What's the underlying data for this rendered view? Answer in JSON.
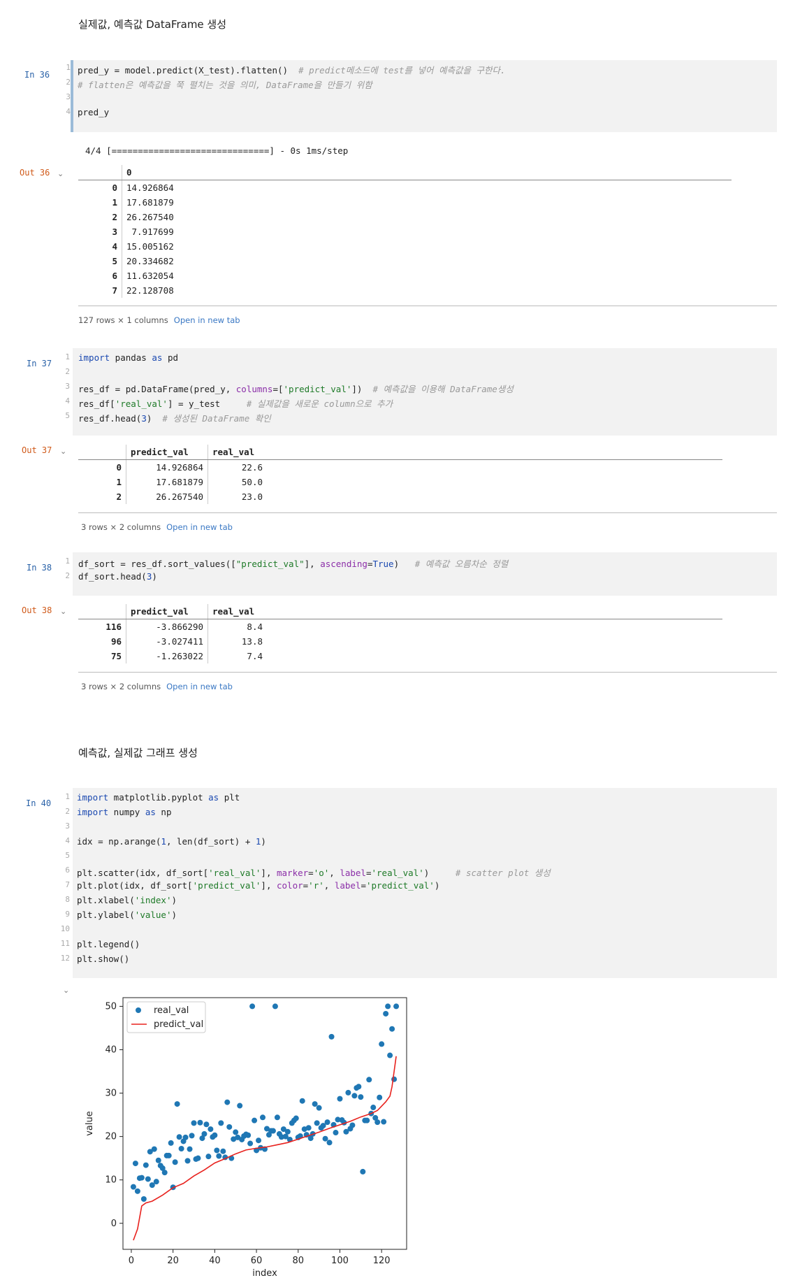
{
  "md1": "실제값, 예측값 DataFrame 생성",
  "md2": "예측값, 실제값 그래프 생성",
  "cells": {
    "in36": "In 36",
    "out36": "Out 36",
    "in37": "In 37",
    "out37": "Out 37",
    "in38": "In 38",
    "out38": "Out 38",
    "in40": "In 40"
  },
  "progress_line": "4/4 [==============================] - 0s 1ms/step",
  "table36": {
    "column": "0",
    "rows": [
      {
        "idx": "0",
        "val": "14.926864"
      },
      {
        "idx": "1",
        "val": "17.681879"
      },
      {
        "idx": "2",
        "val": "26.267540"
      },
      {
        "idx": "3",
        "val": "7.917699"
      },
      {
        "idx": "4",
        "val": "15.005162"
      },
      {
        "idx": "5",
        "val": "20.334682"
      },
      {
        "idx": "6",
        "val": "11.632054"
      },
      {
        "idx": "7",
        "val": "22.128708"
      }
    ],
    "footer": "127 rows × 1 columns",
    "link": "Open in new tab"
  },
  "table37": {
    "columns": [
      "predict_val",
      "real_val"
    ],
    "rows": [
      {
        "idx": "0",
        "a": "14.926864",
        "b": "22.6"
      },
      {
        "idx": "1",
        "a": "17.681879",
        "b": "50.0"
      },
      {
        "idx": "2",
        "a": "26.267540",
        "b": "23.0"
      }
    ],
    "footer": "3 rows × 2 columns",
    "link": "Open in new tab"
  },
  "table38": {
    "columns": [
      "predict_val",
      "real_val"
    ],
    "rows": [
      {
        "idx": "116",
        "a": "-3.866290",
        "b": "8.4"
      },
      {
        "idx": "96",
        "a": "-3.027411",
        "b": "13.8"
      },
      {
        "idx": "75",
        "a": "-1.263022",
        "b": "7.4"
      }
    ],
    "footer": "3 rows × 2 columns",
    "link": "Open in new tab"
  },
  "chart_data": {
    "type": "scatter",
    "xlabel": "index",
    "ylabel": "value",
    "xlim": [
      -4,
      132
    ],
    "ylim": [
      -6,
      52
    ],
    "xticks": [
      0,
      20,
      40,
      60,
      80,
      100,
      120
    ],
    "yticks": [
      0,
      10,
      20,
      30,
      40,
      50
    ],
    "legend": "top-left",
    "series": [
      {
        "name": "real_val",
        "kind": "scatter",
        "color": "#1f77b4",
        "x": [
          1,
          2,
          3,
          4,
          5,
          6,
          7,
          8,
          9,
          10,
          11,
          12,
          13,
          14,
          15,
          16,
          17,
          18,
          19,
          20,
          21,
          22,
          23,
          24,
          25,
          26,
          27,
          28,
          29,
          30,
          31,
          32,
          33,
          34,
          35,
          36,
          37,
          38,
          39,
          40,
          41,
          42,
          43,
          44,
          45,
          46,
          47,
          48,
          49,
          50,
          51,
          52,
          53,
          54,
          55,
          56,
          57,
          58,
          59,
          60,
          61,
          62,
          63,
          64,
          65,
          66,
          67,
          68,
          69,
          70,
          71,
          72,
          73,
          74,
          75,
          76,
          77,
          78,
          79,
          80,
          81,
          82,
          83,
          84,
          85,
          86,
          87,
          88,
          89,
          90,
          91,
          92,
          93,
          94,
          95,
          96,
          97,
          98,
          99,
          100,
          101,
          102,
          103,
          104,
          105,
          106,
          107,
          108,
          109,
          110,
          111,
          112,
          113,
          114,
          115,
          116,
          117,
          118,
          119,
          120,
          121,
          122,
          123,
          124,
          125,
          126,
          127
        ],
        "y": [
          8.4,
          13.8,
          7.4,
          10.4,
          10.5,
          5.6,
          13.4,
          10.2,
          16.5,
          8.8,
          17.1,
          9.6,
          14.5,
          13.3,
          12.7,
          11.7,
          15.6,
          15.6,
          18.5,
          8.3,
          14.1,
          27.5,
          19.9,
          17.2,
          18.9,
          19.8,
          14.4,
          17.1,
          20.2,
          23.1,
          14.8,
          15.0,
          23.2,
          19.6,
          20.6,
          22.8,
          15.4,
          21.7,
          19.9,
          20.3,
          16.8,
          15.5,
          23.1,
          16.6,
          15.2,
          27.9,
          22.2,
          15.0,
          19.4,
          21.0,
          19.8,
          27.1,
          19.3,
          20.1,
          20.5,
          20.3,
          18.4,
          50.0,
          23.7,
          16.8,
          19.1,
          17.4,
          24.4,
          17.1,
          21.8,
          20.4,
          21.3,
          21.3,
          50.0,
          24.4,
          20.6,
          19.9,
          21.7,
          20.0,
          21.1,
          19.3,
          23.1,
          23.7,
          24.2,
          19.8,
          20.1,
          28.2,
          21.7,
          20.4,
          22.0,
          19.6,
          20.6,
          27.5,
          23.1,
          26.6,
          22.0,
          22.5,
          19.5,
          23.3,
          18.6,
          43.0,
          22.7,
          20.9,
          23.9,
          28.7,
          23.8,
          23.2,
          21.1,
          30.1,
          21.8,
          22.6,
          29.4,
          31.2,
          31.5,
          29.1,
          11.9,
          23.7,
          23.7,
          33.1,
          25.3,
          26.7,
          24.3,
          23.3,
          29.0,
          41.3,
          23.4,
          48.3,
          50.0,
          38.7,
          44.8,
          33.2,
          50.0
        ]
      },
      {
        "name": "predict_val",
        "kind": "line",
        "color": "#e8221e",
        "x": [
          1,
          3,
          5,
          7,
          10,
          15,
          20,
          25,
          30,
          35,
          40,
          45,
          50,
          55,
          60,
          65,
          70,
          75,
          80,
          85,
          90,
          95,
          100,
          105,
          110,
          115,
          118,
          120,
          122,
          124,
          125,
          126,
          127
        ],
        "y": [
          -3.9,
          -1.3,
          4.0,
          4.7,
          5.1,
          6.5,
          8.2,
          9.2,
          10.9,
          12.3,
          13.9,
          14.9,
          16.0,
          16.9,
          17.3,
          17.6,
          18.1,
          18.6,
          19.4,
          20.2,
          21.0,
          21.9,
          22.7,
          23.5,
          24.5,
          25.3,
          26.0,
          27.0,
          28.0,
          29.3,
          31.5,
          35.0,
          38.5
        ]
      }
    ]
  }
}
